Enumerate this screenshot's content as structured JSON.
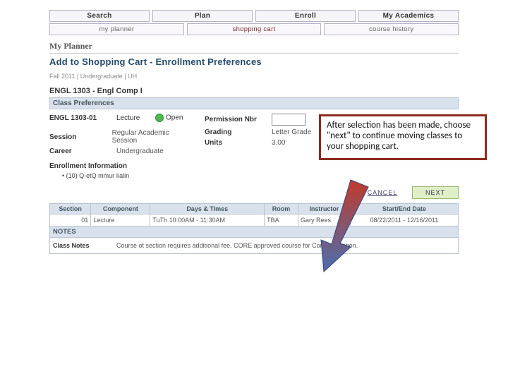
{
  "tabs": {
    "primary": [
      "Search",
      "Plan",
      "Enroll",
      "My Academics"
    ],
    "sub": [
      "my planner",
      "shopping cart",
      "course history"
    ]
  },
  "headings": {
    "planner": "My Planner",
    "add": "Add to Shopping Cart - Enrollment Preferences"
  },
  "context": "Fall 2011 | Undergraduate | UH",
  "course": "ENGL 1303 - Engl Comp I",
  "section_bar": "Class Preferences",
  "prefs": {
    "code": "ENGL 1303-01",
    "component": "Lecture",
    "status": "Open",
    "perm_label": "Permission Nbr",
    "perm_value": "",
    "session_label": "Session",
    "session_value": "Regular Academic Session",
    "grading_label": "Grading",
    "grading_value": "Letter Grade",
    "career_label": "Career",
    "career_value": "Undergraduate",
    "units_label": "Units",
    "units_value": "3.00"
  },
  "enroll_info": {
    "heading": "Enrollment Information",
    "bullet": "(10) Q-etQ mmur Iialin"
  },
  "buttons": {
    "cancel": "CANCEL",
    "next": "NEXT"
  },
  "sched": {
    "headers": [
      "Section",
      "Component",
      "Days & Times",
      "Room",
      "Instructor",
      "Start/End Date"
    ],
    "row": {
      "section": "01",
      "component": "Lecture",
      "days": "TuTh 10:00AM - 11:30AM",
      "room": "TBA",
      "instructor": "Gary Rees",
      "dates": "08/22/2011 - 12/16/2011"
    }
  },
  "notes": {
    "bar": "NOTES",
    "label": "Class Notes",
    "text": "Course ot section requires additional fee. CORE approved course for Communication."
  },
  "callout": "After selection has been made, choose \"next\" to continue moving classes to your shopping cart."
}
